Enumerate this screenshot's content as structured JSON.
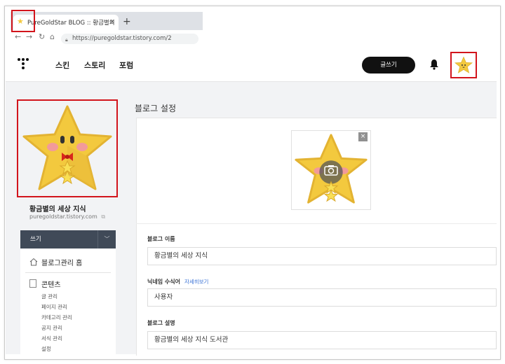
{
  "browser": {
    "tab_title": "PureGoldStar BLOG :: 황금별의",
    "tab_close": "×",
    "new_tab": "+",
    "url": "https://puregoldstar.tistory.com/2"
  },
  "header": {
    "nav": [
      "스킨",
      "스토리",
      "포럼"
    ],
    "write_button": "글쓰기"
  },
  "sidebar": {
    "blog_name": "황금별의 세상 지식",
    "blog_url": "puregoldstar.tistory.com",
    "write_label": "쓰기",
    "home_label": "블로그관리 홈",
    "contents_label": "콘텐츠",
    "sub_items": [
      "글 관리",
      "페이지 관리",
      "카테고리 관리",
      "공지 관리",
      "서식 관리",
      "설정"
    ]
  },
  "main": {
    "page_title": "블로그 설정",
    "fields": {
      "blog_name_label": "블로그 이름",
      "blog_name_value": "황금별의 세상 지식",
      "nickname_label": "닉네임 수식어",
      "nickname_link": "자세히보기",
      "nickname_value": "사용자",
      "desc_label": "블로그 설명",
      "desc_value": "황금별의 세상 지식 도서관"
    },
    "image_close": "×"
  },
  "colors": {
    "highlight": "#d2141c",
    "star": "#f3c93e",
    "sidebar_dark": "#404a58"
  },
  "icons": [
    "star-favicon",
    "back-arrow-icon",
    "forward-arrow-icon",
    "reload-icon",
    "home-icon",
    "lock-icon",
    "tistory-logo",
    "bell-icon",
    "chevron-down-icon",
    "external-link-icon",
    "house-icon",
    "document-icon",
    "camera-icon"
  ]
}
